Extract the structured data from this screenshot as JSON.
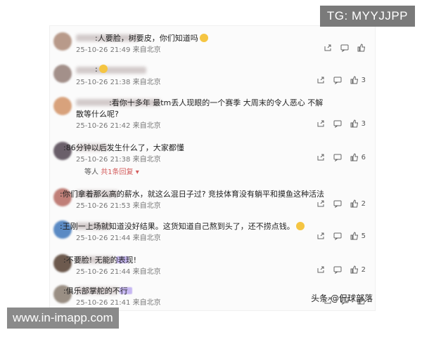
{
  "overlay": {
    "tg": "TG: MYYJJPP",
    "watermark": "www.in-imapp.com",
    "source": "头条 @侃球部落"
  },
  "comments": [
    {
      "text": ":人要脸，树要皮，你们知道吗",
      "emoji": true,
      "time": "25-10-26 21:49",
      "loc": "来自北京",
      "likes": ""
    },
    {
      "text": ":",
      "emoji": true,
      "time": "25-10-26 21:38",
      "loc": "来自北京",
      "likes": "3"
    },
    {
      "text": ":看你十多年 最tm丢人现眼的一个赛季 大周末的令人恶心 不解",
      "text2": "散等什么呢?",
      "time": "25-10-26 21:42",
      "loc": "来自北京",
      "likes": "3"
    },
    {
      "text": ":86分钟以后发生什么了，大家都懂",
      "time": "25-10-26 21:38",
      "loc": "来自北京",
      "likes": "6",
      "reply": {
        "author": "等人",
        "more": "共1条回复"
      }
    },
    {
      "text": ":你们拿着那么高的薪水，就这么混日子过? 竞技体育没有躺平和摸鱼这种活法",
      "time": "25-10-26 21:53",
      "loc": "来自北京",
      "likes": "2"
    },
    {
      "text": ":王刚一上场就知道没好结果。这货知道自己熬到头了，还不捞点钱。",
      "emoji": true,
      "time": "25-10-26 21:44",
      "loc": "来自北京",
      "likes": "5"
    },
    {
      "text": ":不要脸! 无能的表现!",
      "time": "25-10-26 21:44",
      "loc": "来自北京",
      "likes": "2"
    },
    {
      "text": ":俱乐部掌舵的不行",
      "time": "25-10-26 21:41",
      "loc": "来自北京",
      "likes": ""
    }
  ],
  "colors": {
    "avatar": [
      "#b89a8a",
      "#a3908a",
      "#d8a27c",
      "#6a5f6a",
      "#c07f78",
      "#5a8ac4",
      "#6d5a4e",
      "#9a8f84"
    ]
  }
}
